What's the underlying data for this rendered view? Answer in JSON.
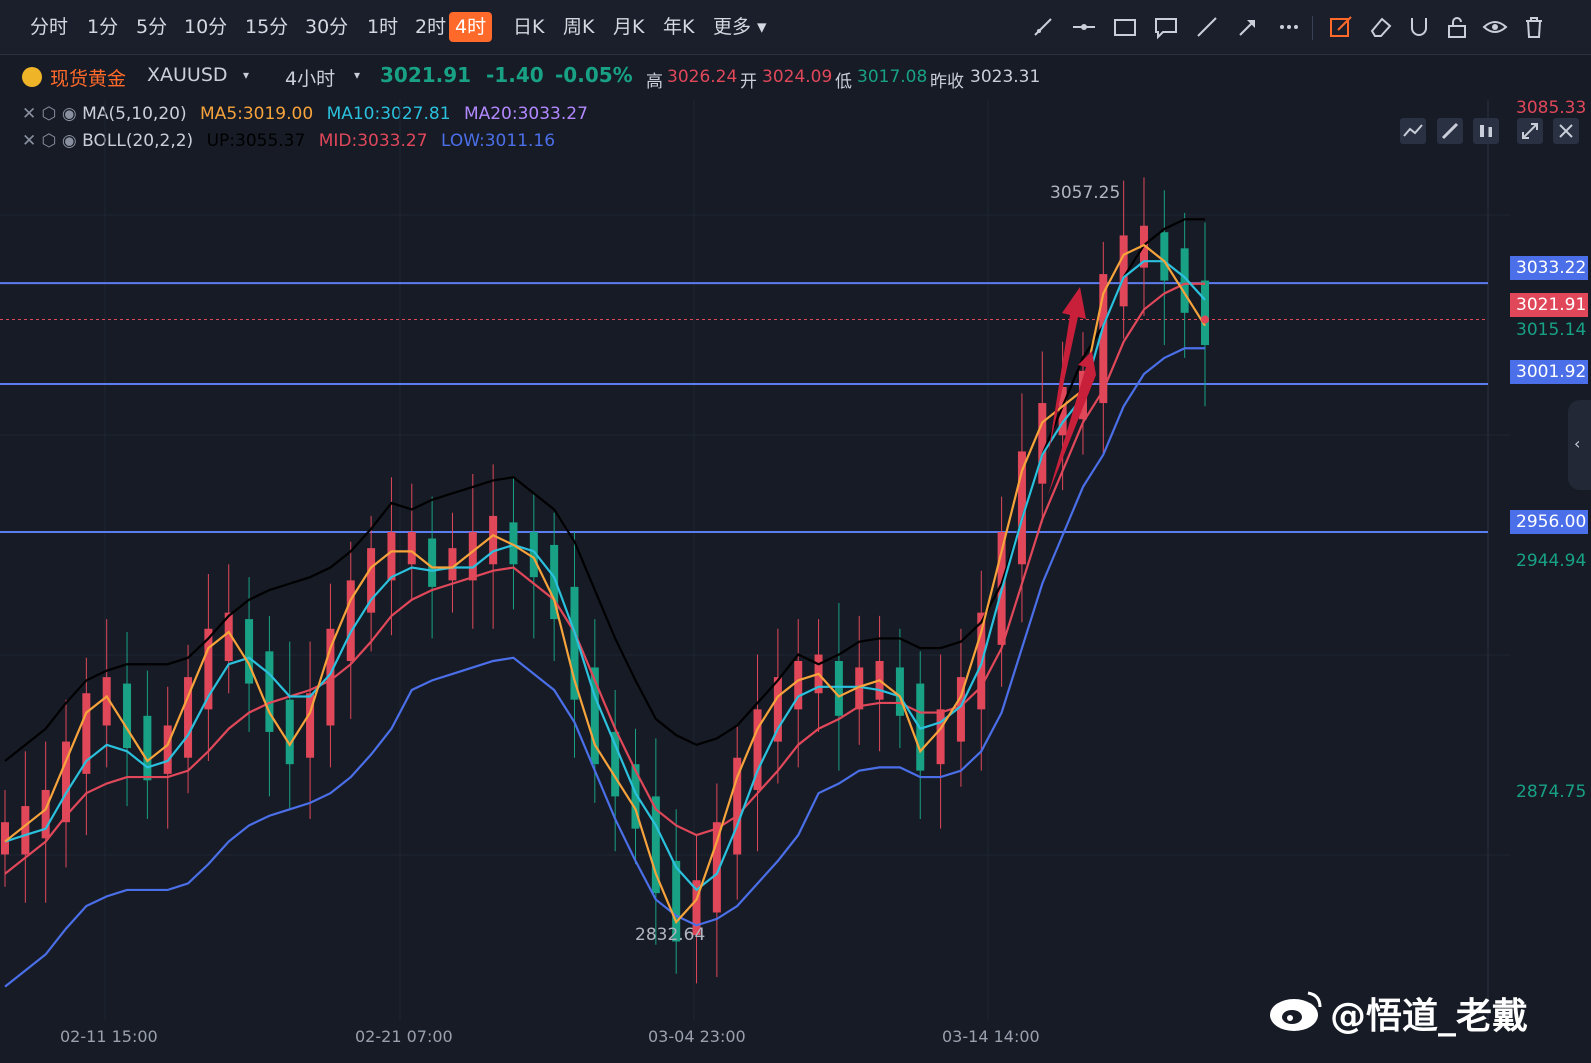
{
  "timeframes": [
    "分时",
    "1分",
    "5分",
    "10分",
    "15分",
    "30分",
    "1时",
    "2时",
    "4时",
    "日K",
    "周K",
    "月K",
    "年K",
    "更多"
  ],
  "active_timeframe": "4时",
  "symbol": {
    "name": "现货黄金",
    "code": "XAUUSD",
    "interval": "4小时"
  },
  "quote": {
    "last": "3021.91",
    "change": "-1.40",
    "change_pct": "-0.05%",
    "high_label": "高",
    "high": "3026.24",
    "open_label": "开",
    "open": "3024.09",
    "low_label": "低",
    "low": "3017.08",
    "prev_label": "昨收",
    "prev": "3023.31"
  },
  "indicators": {
    "ma": {
      "name": "MA(5,10,20)",
      "ma5": "MA5:3019.00",
      "ma10": "MA10:3027.81",
      "ma20": "MA20:3033.27"
    },
    "boll": {
      "name": "BOLL(20,2,2)",
      "up": "UP:3055.37",
      "mid": "MID:3033.27",
      "low": "LOW:3011.16"
    }
  },
  "colors": {
    "bg": "#161b26",
    "up": "#e0485a",
    "down": "#18a185",
    "ma5": "#f7a33c",
    "ma10": "#2bc0dc",
    "ma20": "#e0485a",
    "boll_up": "#000000",
    "boll_low": "#4b6fe8",
    "hline": "#5b7df0"
  },
  "chart_data": {
    "type": "candlestick",
    "x_tick_labels": [
      "02-11 15:00",
      "02-21 07:00",
      "03-04 23:00",
      "03-14 14:00"
    ],
    "y_range": [
      2800,
      3090
    ],
    "price_axis_labels": [
      "3085.33",
      "3015.14",
      "2944.94",
      "2874.75"
    ],
    "horizontal_lines": [
      "3033.22",
      "3001.92",
      "2956.00"
    ],
    "current_price": "3021.91",
    "annotations": {
      "high": "3057.25",
      "low": "2832.64"
    },
    "ma5": [
      2860,
      2865,
      2870,
      2885,
      2900,
      2905,
      2895,
      2885,
      2890,
      2905,
      2920,
      2925,
      2915,
      2900,
      2890,
      2900,
      2920,
      2935,
      2945,
      2950,
      2950,
      2945,
      2945,
      2950,
      2955,
      2952,
      2948,
      2935,
      2910,
      2890,
      2880,
      2870,
      2850,
      2835,
      2842,
      2860,
      2880,
      2895,
      2905,
      2910,
      2912,
      2905,
      2908,
      2910,
      2905,
      2888,
      2895,
      2905,
      2925,
      2950,
      2975,
      2990,
      2995,
      3000,
      3030,
      3042,
      3045,
      3040,
      3030,
      3020
    ],
    "ma10": [
      2860,
      2862,
      2864,
      2875,
      2885,
      2890,
      2888,
      2883,
      2885,
      2893,
      2905,
      2915,
      2917,
      2912,
      2905,
      2905,
      2912,
      2925,
      2935,
      2942,
      2945,
      2944,
      2945,
      2945,
      2950,
      2952,
      2950,
      2942,
      2925,
      2905,
      2890,
      2875,
      2865,
      2852,
      2845,
      2850,
      2865,
      2882,
      2895,
      2905,
      2908,
      2908,
      2908,
      2907,
      2905,
      2895,
      2897,
      2902,
      2915,
      2938,
      2960,
      2980,
      2990,
      2998,
      3020,
      3035,
      3040,
      3040,
      3035,
      3028
    ],
    "ma20": [
      2850,
      2855,
      2860,
      2868,
      2875,
      2878,
      2880,
      2880,
      2880,
      2882,
      2888,
      2895,
      2900,
      2903,
      2905,
      2907,
      2910,
      2915,
      2922,
      2930,
      2935,
      2938,
      2940,
      2942,
      2944,
      2945,
      2940,
      2935,
      2925,
      2910,
      2895,
      2882,
      2870,
      2865,
      2862,
      2864,
      2868,
      2875,
      2882,
      2890,
      2895,
      2898,
      2902,
      2903,
      2903,
      2900,
      2900,
      2902,
      2908,
      2920,
      2940,
      2960,
      2975,
      2990,
      3000,
      3015,
      3025,
      3030,
      3033,
      3033
    ]
  },
  "watermark": "@悟道_老戴"
}
